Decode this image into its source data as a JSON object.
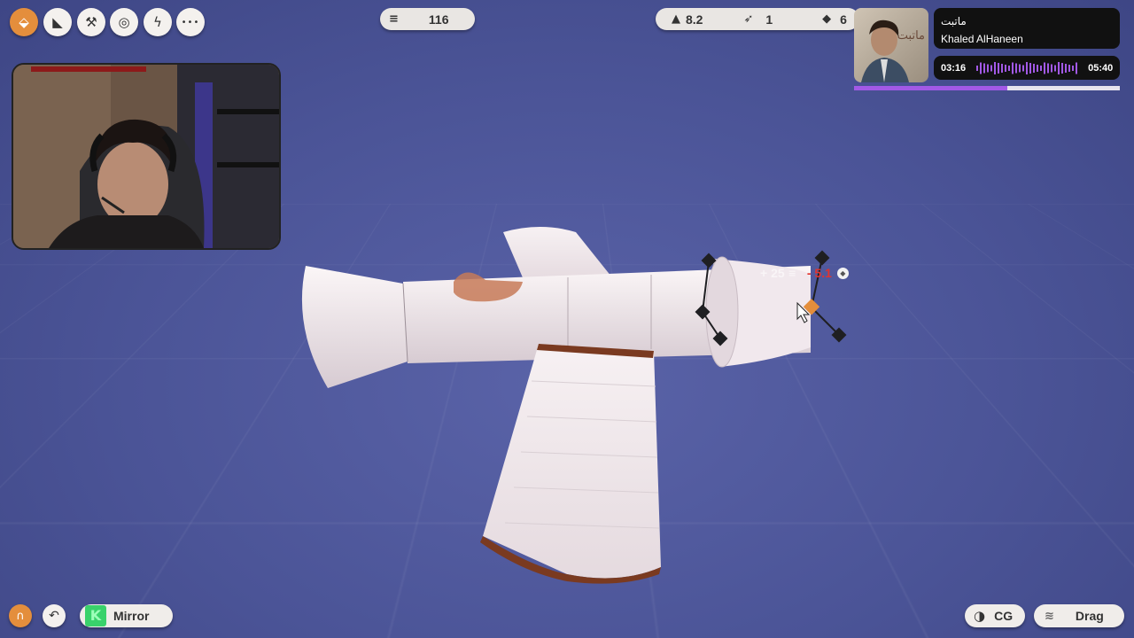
{
  "toolbar": {
    "tools": [
      {
        "icon": "part-tool-icon",
        "glyph": "⬙",
        "active": true
      },
      {
        "icon": "wing-tool-icon",
        "glyph": "◣",
        "active": false
      },
      {
        "icon": "hammer-tool-icon",
        "glyph": "⚒",
        "active": false
      },
      {
        "icon": "wheel-tool-icon",
        "glyph": "◎",
        "active": false
      },
      {
        "icon": "engine-tool-icon",
        "glyph": "ϟ",
        "active": false
      },
      {
        "icon": "more-icon",
        "glyph": "•••",
        "active": false
      }
    ]
  },
  "stats": {
    "cost_value": "116",
    "mass_value": "8.2",
    "thrust_value": "1",
    "parts_value": "6"
  },
  "music": {
    "title": "ماتبت",
    "artist": "Khaled AlHaneen",
    "elapsed": "03:16",
    "duration": "05:40",
    "progress": 0.575,
    "album_text": "ماتبت",
    "accent": "#a259e6"
  },
  "part_overlay": {
    "cost_delta": "+ 25",
    "mass_delta": "- 5.1"
  },
  "bottom": {
    "mirror_label": "Mirror",
    "cg_label": "CG",
    "drag_label": "Drag"
  },
  "colors": {
    "accent_orange": "#e48e3c",
    "background": "#4b5497",
    "negative_red": "#e0342f"
  }
}
